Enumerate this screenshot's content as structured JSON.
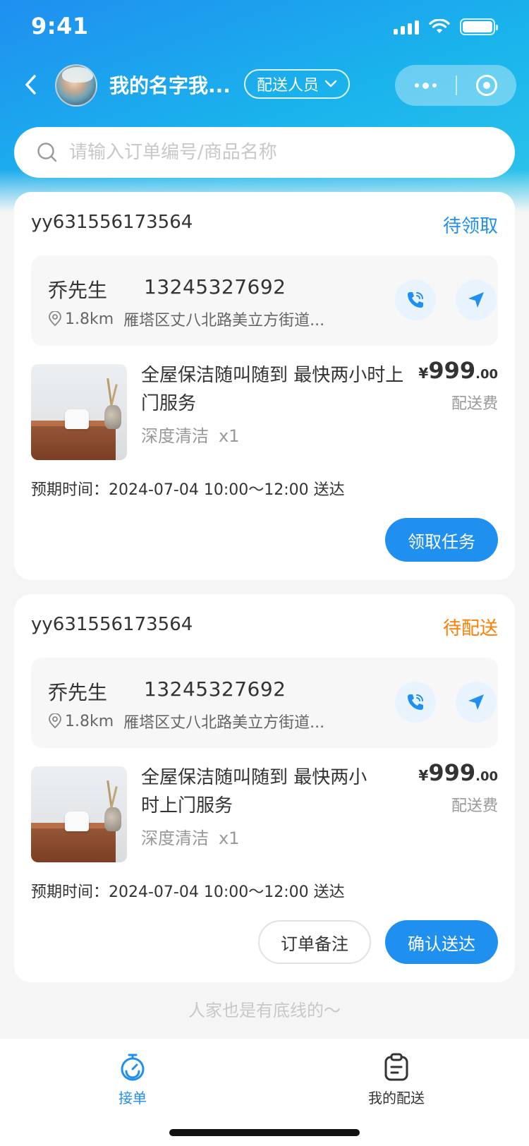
{
  "status_bar": {
    "time": "9:41"
  },
  "nav": {
    "name": "我的名字我...",
    "role": "配送人员"
  },
  "search": {
    "placeholder": "请输入订单编号/商品名称"
  },
  "orders": [
    {
      "order_no": "yy631556173564",
      "status": "待领取",
      "status_color": "#1f8ff0",
      "customer_name": "乔先生",
      "customer_phone": "13245327692",
      "distance": "1.8km",
      "address": "雁塔区丈八北路美立方街道...",
      "product_title": "全屋保洁随叫随到 最快两小时上门服务",
      "product_spec": "深度清洁",
      "product_qty": "x1",
      "price_symbol": "¥",
      "price_int": "999",
      "price_dec": ".00",
      "fee_label": "配送费",
      "eta": "预期时间：2024-07-04 10:00～12:00 送达",
      "buttons": [
        "领取任务"
      ]
    },
    {
      "order_no": "yy631556173564",
      "status": "待配送",
      "status_color": "#ff7d00",
      "customer_name": "乔先生",
      "customer_phone": "13245327692",
      "distance": "1.8km",
      "address": "雁塔区丈八北路美立方街道...",
      "product_title": "全屋保洁随叫随到 最快两小时上门服务",
      "product_spec": "深度清洁",
      "product_qty": "x1",
      "price_symbol": "¥",
      "price_int": "999",
      "price_dec": ".00",
      "fee_label": "配送费",
      "eta": "预期时间：2024-07-04 10:00～12:00 送达",
      "buttons": [
        "订单备注",
        "确认送达"
      ]
    }
  ],
  "footer_hint": "人家也是有底线的～",
  "tabbar": {
    "items": [
      {
        "label": "接单",
        "icon": "stopwatch-icon",
        "active": true
      },
      {
        "label": "我的配送",
        "icon": "clipboard-icon",
        "active": false
      }
    ]
  },
  "colors": {
    "primary": "#1f8ff0",
    "orange": "#ff7d00"
  }
}
